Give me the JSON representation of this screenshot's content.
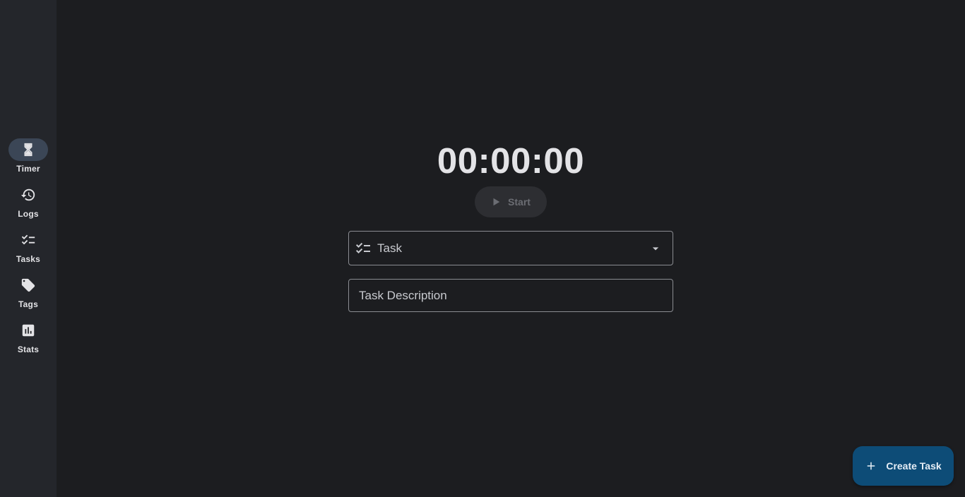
{
  "nav": {
    "items": [
      {
        "label": "Timer",
        "icon": "hourglass-icon",
        "active": true
      },
      {
        "label": "Logs",
        "icon": "history-icon",
        "active": false
      },
      {
        "label": "Tasks",
        "icon": "checklist-icon",
        "active": false
      },
      {
        "label": "Tags",
        "icon": "tag-icon",
        "active": false
      },
      {
        "label": "Stats",
        "icon": "chart-icon",
        "active": false
      }
    ]
  },
  "timer": {
    "display": "00:00:00",
    "start_label": "Start"
  },
  "form": {
    "task_label": "Task",
    "description_placeholder": "Task Description",
    "description_value": ""
  },
  "fab": {
    "label": "Create Task"
  },
  "colors": {
    "background": "#1c1d20",
    "rail": "#24262b",
    "active_pill": "#3b4656",
    "fab": "#0d4c77"
  }
}
